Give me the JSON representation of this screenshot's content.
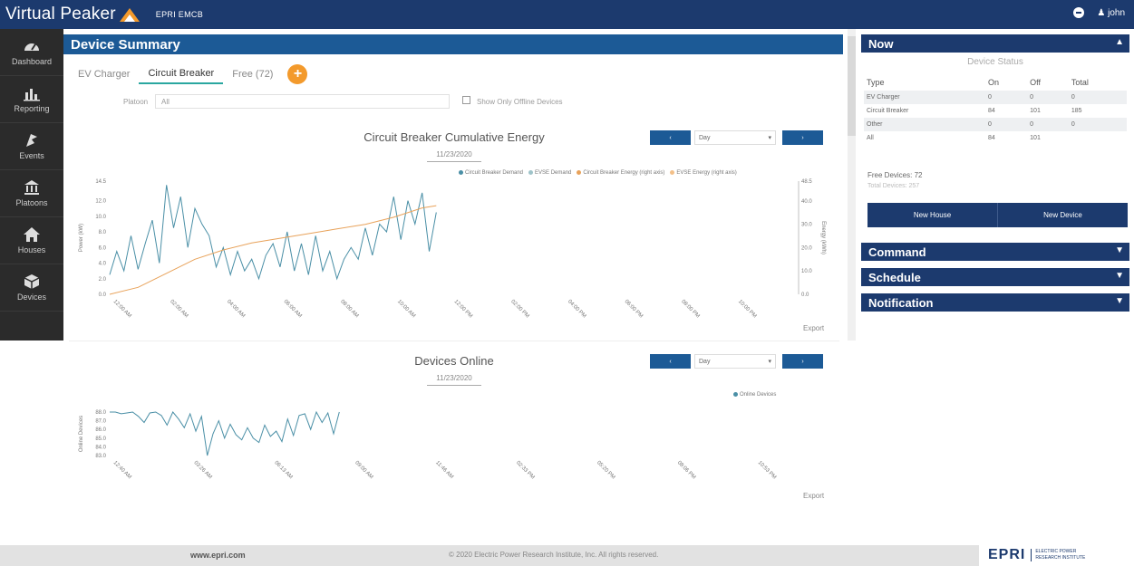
{
  "app": {
    "brand": "Virtual Peaker",
    "environment": "EPRI EMCB",
    "user": "john"
  },
  "sidebar": {
    "items": [
      {
        "label": "Dashboard",
        "icon": "dashboard-icon"
      },
      {
        "label": "Reporting",
        "icon": "bar-chart-icon"
      },
      {
        "label": "Events",
        "icon": "events-icon"
      },
      {
        "label": "Platoons",
        "icon": "building-icon"
      },
      {
        "label": "Houses",
        "icon": "home-icon"
      },
      {
        "label": "Devices",
        "icon": "cube-icon"
      }
    ]
  },
  "device_summary": {
    "title": "Device Summary",
    "tabs": [
      "EV Charger",
      "Circuit Breaker",
      "Free (72)"
    ],
    "active_tab": "Circuit Breaker",
    "add_label": "+",
    "platoon_label": "Platoon",
    "platoon_value": "All",
    "offline_label": "Show Only Offline Devices"
  },
  "chart_data": [
    {
      "type": "line",
      "title": "Circuit Breaker Cumulative Energy",
      "date": "11/23/2020",
      "range": "Day",
      "prev_label": "‹",
      "next_label": "›",
      "export_label": "Export",
      "ylabel": "Power (kW)",
      "y2label": "Energy (kWh)",
      "ylim": [
        0,
        14.5
      ],
      "y2lim": [
        0,
        48.5
      ],
      "yticks": [
        "0.0",
        "2.0",
        "4.0",
        "6.0",
        "8.0",
        "10.0",
        "12.0",
        "14.5"
      ],
      "y2ticks": [
        "0.0",
        "10.0",
        "20.0",
        "30.0",
        "40.0",
        "48.5"
      ],
      "xticks": [
        "12:00 AM",
        "02:00 AM",
        "04:00 AM",
        "06:00 AM",
        "08:00 AM",
        "10:00 AM",
        "12:00 PM",
        "02:00 PM",
        "04:00 PM",
        "06:00 PM",
        "08:00 PM",
        "10:00 PM"
      ],
      "legend": [
        "Circuit Breaker Demand",
        "EVSE Demand",
        "Circuit Breaker Energy (right axis)",
        "EVSE Energy (right axis)"
      ],
      "legend_colors": [
        "#4a8fa6",
        "#9ec3c9",
        "#e8a25a",
        "#f3c089"
      ],
      "series": [
        {
          "name": "Circuit Breaker Demand",
          "color": "#4a8fa6",
          "x": [
            0,
            0.25,
            0.5,
            0.75,
            1,
            1.25,
            1.5,
            1.75,
            2,
            2.25,
            2.5,
            2.75,
            3,
            3.25,
            3.5,
            3.75,
            4,
            4.25,
            4.5,
            4.75,
            5,
            5.25,
            5.5,
            5.75,
            6,
            6.25,
            6.5,
            6.75,
            7,
            7.25,
            7.5,
            7.75,
            8,
            8.25,
            8.5,
            8.75,
            9,
            9.25,
            9.5,
            9.75,
            10,
            10.25,
            10.5,
            10.75,
            11,
            11.25,
            11.5
          ],
          "values": [
            2.5,
            5.5,
            3.0,
            7.5,
            3.2,
            6.5,
            9.5,
            4.0,
            14.0,
            8.5,
            12.5,
            6.0,
            11.0,
            9.0,
            7.5,
            3.5,
            6.0,
            2.5,
            5.5,
            3.0,
            4.5,
            2.0,
            5.0,
            6.5,
            3.5,
            8.0,
            3.0,
            6.5,
            2.5,
            7.5,
            3.0,
            5.5,
            2.0,
            4.5,
            6.0,
            4.5,
            8.5,
            5.0,
            9.0,
            8.0,
            12.5,
            7.0,
            12.0,
            9.0,
            13.0,
            5.5,
            10.5
          ]
        },
        {
          "name": "Circuit Breaker Energy (right axis)",
          "color": "#e8a25a",
          "x": [
            0,
            1,
            2,
            3,
            4,
            5,
            6,
            7,
            8,
            9,
            10,
            11,
            11.5
          ],
          "values": [
            0,
            3,
            9,
            15,
            19,
            22,
            24,
            26,
            28,
            30,
            33,
            37,
            38
          ]
        }
      ]
    },
    {
      "type": "line",
      "title": "Devices Online",
      "date": "11/23/2020",
      "range": "Day",
      "prev_label": "‹",
      "next_label": "›",
      "export_label": "Export",
      "ylabel": "Online Devices",
      "ylim": [
        83,
        88
      ],
      "yticks": [
        "83.0",
        "84.0",
        "85.0",
        "86.0",
        "87.0",
        "88.0"
      ],
      "xticks": [
        "12:40 AM",
        "03:26 AM",
        "06:13 AM",
        "09:00 AM",
        "11:46 AM",
        "02:33 PM",
        "05:20 PM",
        "08:06 PM",
        "10:53 PM"
      ],
      "legend": [
        "Online Devices"
      ],
      "legend_colors": [
        "#4a8fa6"
      ],
      "series": [
        {
          "name": "Online Devices",
          "color": "#4a8fa6",
          "x": [
            0,
            0.2,
            0.4,
            0.6,
            0.8,
            1.0,
            1.2,
            1.4,
            1.6,
            1.8,
            2.0,
            2.2,
            2.4,
            2.6,
            2.8,
            3.0,
            3.2,
            3.4,
            3.6,
            3.8,
            4.0,
            4.2,
            4.4,
            4.6,
            4.8,
            5.0,
            5.2,
            5.4,
            5.6,
            5.8,
            6.0,
            6.2,
            6.4,
            6.6,
            6.8,
            7.0,
            7.2,
            7.4,
            7.6,
            7.8,
            8.0
          ],
          "values": [
            88,
            88,
            87.8,
            87.9,
            88,
            87.5,
            86.8,
            87.9,
            88,
            87.6,
            86.5,
            88,
            87.2,
            86.2,
            87.8,
            85.8,
            87.5,
            83.0,
            85.5,
            87.0,
            85.0,
            86.6,
            85.4,
            84.8,
            86.2,
            85.0,
            84.5,
            86.5,
            85.2,
            85.8,
            84.6,
            87.2,
            85.3,
            87.6,
            87.8,
            86.0,
            88,
            86.8,
            87.9,
            85.5,
            88
          ]
        }
      ]
    }
  ],
  "now_panel": {
    "title": "Now",
    "subtitle": "Device Status",
    "columns": [
      "Type",
      "On",
      "Off",
      "Total"
    ],
    "rows": [
      [
        "EV Charger",
        "0",
        "0",
        "0"
      ],
      [
        "Circuit Breaker",
        "84",
        "101",
        "185"
      ],
      [
        "Other",
        "0",
        "0",
        "0"
      ],
      [
        "All",
        "84",
        "101",
        ""
      ]
    ],
    "free_devices": "Free Devices: 72",
    "total_devices": "Total Devices: 257",
    "buttons": [
      "New House",
      "New Device"
    ]
  },
  "collapsed_panels": [
    "Command",
    "Schedule",
    "Notification"
  ],
  "footer": {
    "url": "www.epri.com",
    "copyright": "© 2020 Electric Power Research Institute, Inc. All rights reserved.",
    "logo_mark": "EPRI",
    "logo_text": "ELECTRIC POWER RESEARCH INSTITUTE"
  }
}
